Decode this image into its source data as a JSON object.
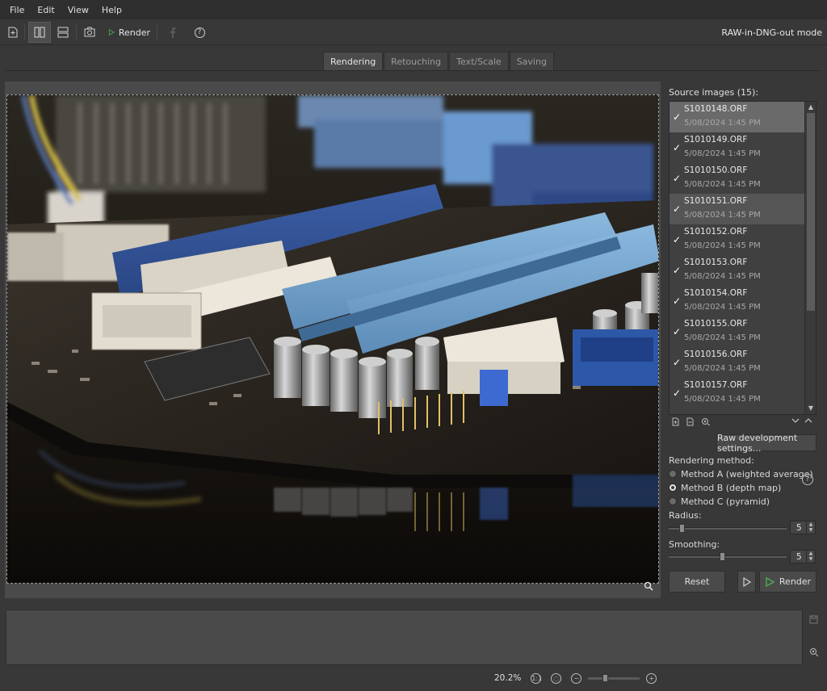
{
  "menu": [
    "File",
    "Edit",
    "View",
    "Help"
  ],
  "toolbar": {
    "render_label": "Render",
    "mode": "RAW-in-DNG-out mode"
  },
  "tabs": [
    {
      "label": "Rendering",
      "active": true
    },
    {
      "label": "Retouching",
      "active": false
    },
    {
      "label": "Text/Scale",
      "active": false
    },
    {
      "label": "Saving",
      "active": false
    }
  ],
  "source": {
    "label": "Source images (15):",
    "files": [
      {
        "name": "S1010148.ORF",
        "date": "5/08/2024 1:45 PM",
        "checked": true,
        "state": "selected"
      },
      {
        "name": "S1010149.ORF",
        "date": "5/08/2024 1:45 PM",
        "checked": true,
        "state": ""
      },
      {
        "name": "S1010150.ORF",
        "date": "5/08/2024 1:45 PM",
        "checked": true,
        "state": ""
      },
      {
        "name": "S1010151.ORF",
        "date": "5/08/2024 1:45 PM",
        "checked": true,
        "state": "hover"
      },
      {
        "name": "S1010152.ORF",
        "date": "5/08/2024 1:45 PM",
        "checked": true,
        "state": ""
      },
      {
        "name": "S1010153.ORF",
        "date": "5/08/2024 1:45 PM",
        "checked": true,
        "state": ""
      },
      {
        "name": "S1010154.ORF",
        "date": "5/08/2024 1:45 PM",
        "checked": true,
        "state": ""
      },
      {
        "name": "S1010155.ORF",
        "date": "5/08/2024 1:45 PM",
        "checked": true,
        "state": ""
      },
      {
        "name": "S1010156.ORF",
        "date": "5/08/2024 1:45 PM",
        "checked": true,
        "state": ""
      },
      {
        "name": "S1010157.ORF",
        "date": "5/08/2024 1:45 PM",
        "checked": true,
        "state": ""
      }
    ]
  },
  "raw_settings_label": "Raw development settings...",
  "rendering": {
    "label": "Rendering method:",
    "methods": [
      {
        "label": "Method A (weighted average)",
        "selected": false
      },
      {
        "label": "Method B (depth map)",
        "selected": true
      },
      {
        "label": "Method C (pyramid)",
        "selected": false
      }
    ],
    "radius_label": "Radius:",
    "radius_value": "5",
    "smoothing_label": "Smoothing:",
    "smoothing_value": "5"
  },
  "actions": {
    "reset_label": "Reset",
    "render_label": "Render"
  },
  "status": {
    "zoom": "20.2%"
  },
  "colors": {
    "accent_green": "#4caf50",
    "background": "#383838",
    "panel": "#4a4a4a"
  }
}
